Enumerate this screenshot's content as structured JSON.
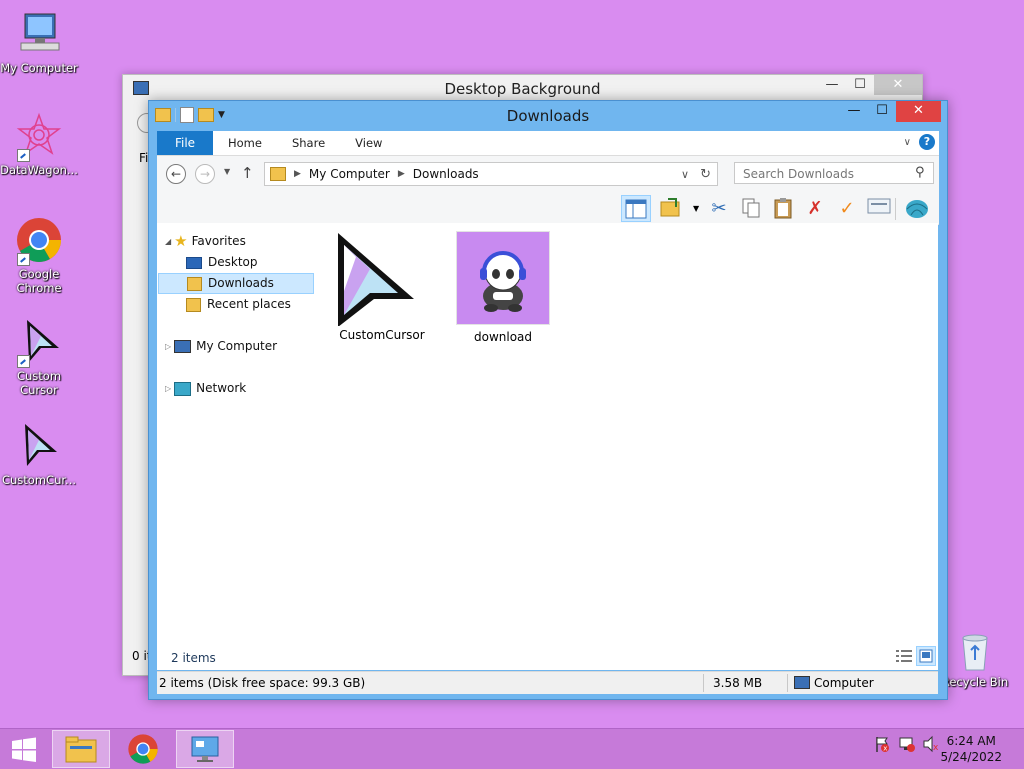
{
  "desktop": {
    "icons": [
      {
        "label": "My Computer"
      },
      {
        "label": "DataWagon..."
      },
      {
        "label": "Google Chrome"
      },
      {
        "label": "Custom Cursor"
      },
      {
        "label": "CustomCur..."
      },
      {
        "label": "Recycle Bin"
      }
    ]
  },
  "background_window": {
    "title": "Desktop Background",
    "left_label_1": "Fi",
    "left_label_2": "0 it"
  },
  "explorer": {
    "title": "Downloads",
    "ribbon_tabs": [
      "File",
      "Home",
      "Share",
      "View"
    ],
    "help": "?",
    "address": {
      "crumbs": [
        "My Computer",
        "Downloads"
      ]
    },
    "search_placeholder": "Search Downloads",
    "nav": {
      "favorites": "Favorites",
      "desktop": "Desktop",
      "downloads": "Downloads",
      "recent": "Recent places",
      "my_computer": "My Computer",
      "network": "Network"
    },
    "files": [
      {
        "name": "CustomCursor"
      },
      {
        "name": "download"
      }
    ],
    "item_count": "2 items",
    "status": {
      "summary": "2 items (Disk free space: 99.3 GB)",
      "size": "3.58 MB",
      "location": "Computer"
    }
  },
  "taskbar": {
    "clock_time": "6:24 AM",
    "clock_date": "5/24/2022"
  }
}
